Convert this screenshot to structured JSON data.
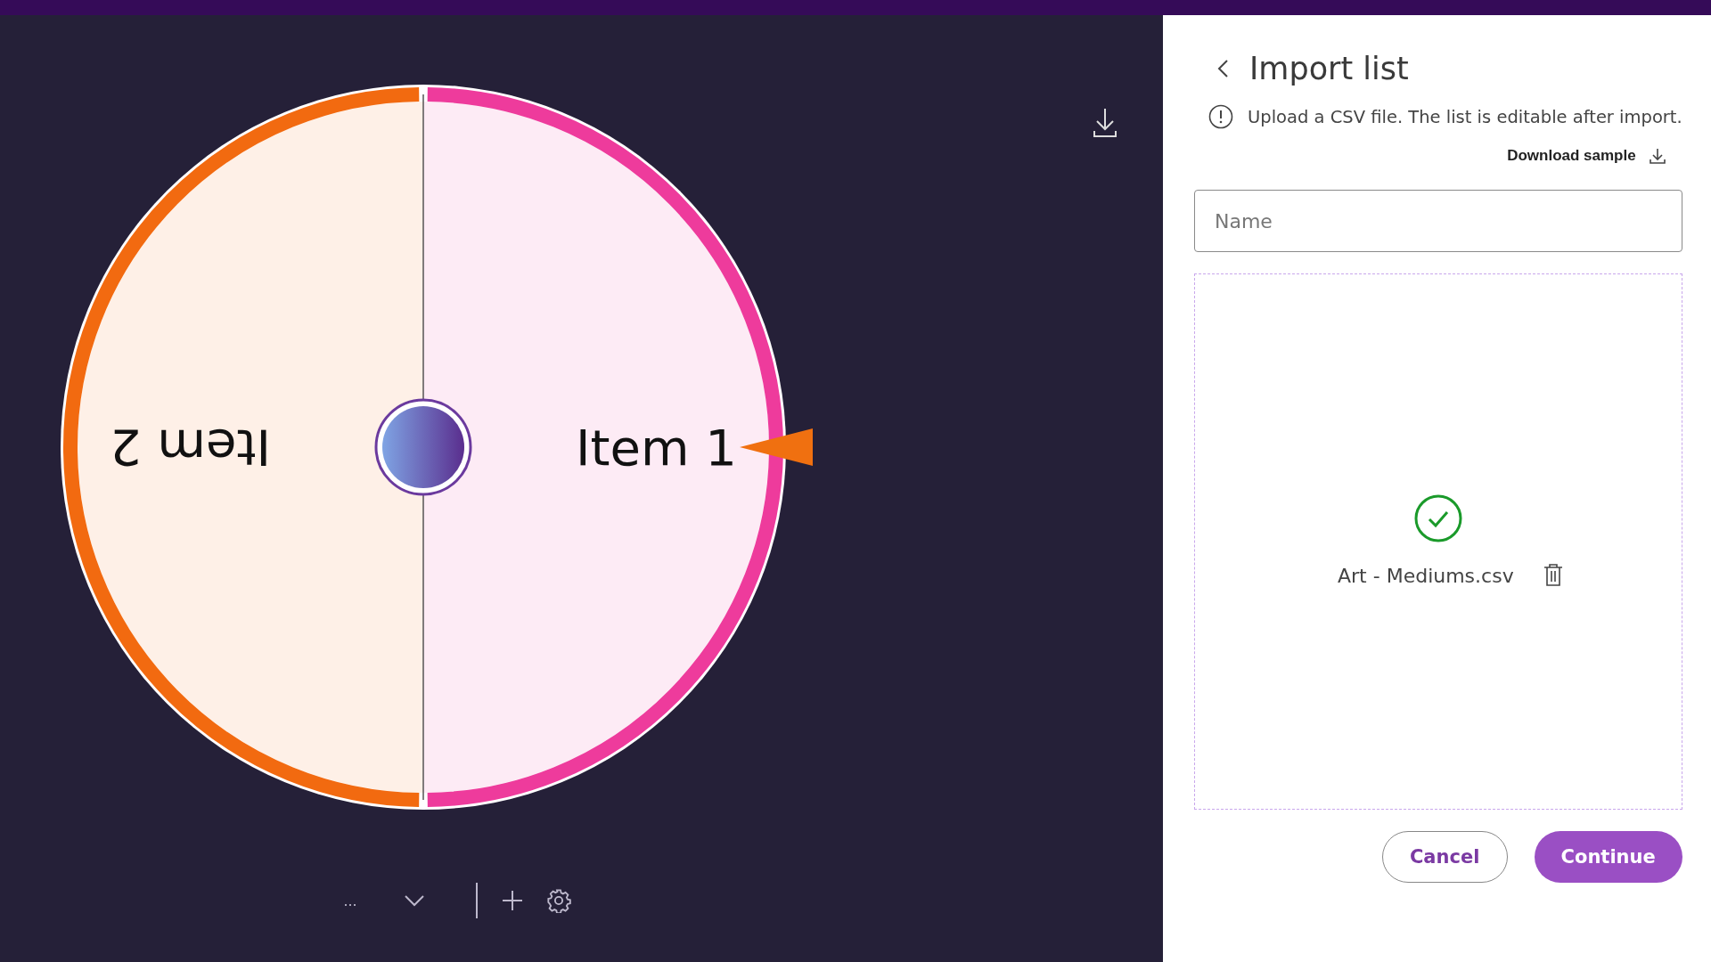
{
  "wheel": {
    "items": [
      {
        "label": "Item 1",
        "color": "#ee3b9c"
      },
      {
        "label": "Item 2",
        "color": "#f26a10"
      }
    ]
  },
  "panel": {
    "title": "Import list",
    "info": "Upload a CSV file. The list is editable after import.",
    "download_sample": "Download sample",
    "name_field": {
      "placeholder": "Name"
    },
    "file": {
      "name": "Art - Mediums.csv"
    },
    "buttons": {
      "cancel": "Cancel",
      "continue": "Continue"
    }
  },
  "toolbar": {
    "more": "..."
  }
}
